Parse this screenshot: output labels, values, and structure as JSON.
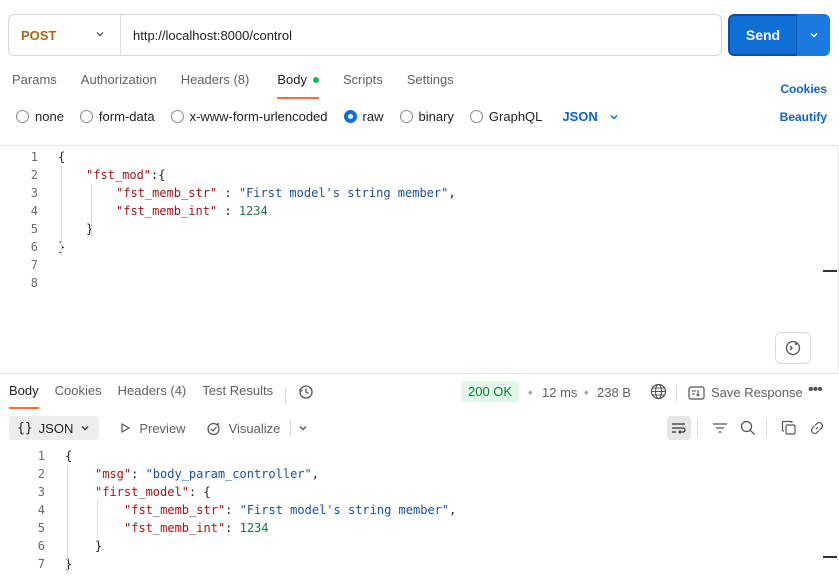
{
  "request": {
    "method": "POST",
    "url": "http://localhost:8000/control",
    "send_label": "Send"
  },
  "request_tabs": {
    "params": "Params",
    "authorization": "Authorization",
    "headers": "Headers",
    "headers_count": "(8)",
    "body": "Body",
    "scripts": "Scripts",
    "settings": "Settings",
    "cookies_link": "Cookies",
    "beautify_link": "Beautify"
  },
  "body_types": {
    "none": "none",
    "form_data": "form-data",
    "urlencoded": "x-www-form-urlencoded",
    "raw": "raw",
    "binary": "binary",
    "graphql": "GraphQL",
    "selected_format": "JSON"
  },
  "request_body_lines": [
    {
      "n": "1",
      "text": "{"
    },
    {
      "n": "2",
      "key": "\"fst_mod\"",
      "rest": ":{"
    },
    {
      "n": "3",
      "key": "\"fst_memb_str\"",
      "rest": " : ",
      "str": "\"First model's string member\"",
      "tail": ","
    },
    {
      "n": "4",
      "key": "\"fst_memb_int\"",
      "rest": " : ",
      "num": "1234"
    },
    {
      "n": "5",
      "text": "}"
    },
    {
      "n": "6",
      "text": "}"
    },
    {
      "n": "7",
      "text": ""
    },
    {
      "n": "8",
      "text": ""
    }
  ],
  "response_tabs": {
    "body": "Body",
    "cookies": "Cookies",
    "headers": "Headers",
    "headers_count": "(4)",
    "test_results": "Test Results"
  },
  "response_meta": {
    "status": "200 OK",
    "time": "12 ms",
    "size": "238 B",
    "save_response": "Save Response"
  },
  "response_toolbar": {
    "format": "JSON",
    "preview": "Preview",
    "visualize": "Visualize"
  },
  "response_body_lines": [
    {
      "n": "1",
      "text": "{"
    },
    {
      "n": "2",
      "key": "\"msg\"",
      "rest": ": ",
      "str": "\"body_param_controller\"",
      "tail": ","
    },
    {
      "n": "3",
      "key": "\"first_model\"",
      "rest": ": {"
    },
    {
      "n": "4",
      "key": "\"fst_memb_str\"",
      "rest": ": ",
      "str": "\"First model's string member\"",
      "tail": ","
    },
    {
      "n": "5",
      "key": "\"fst_memb_int\"",
      "rest": ": ",
      "num": "1234"
    },
    {
      "n": "6",
      "text": "}"
    },
    {
      "n": "7",
      "text": "}"
    }
  ],
  "colors": {
    "accent_orange": "#ff6c37",
    "send_blue": "#0f6fd6",
    "status_green": "#0a7c35",
    "link_blue": "#0b63c9"
  }
}
